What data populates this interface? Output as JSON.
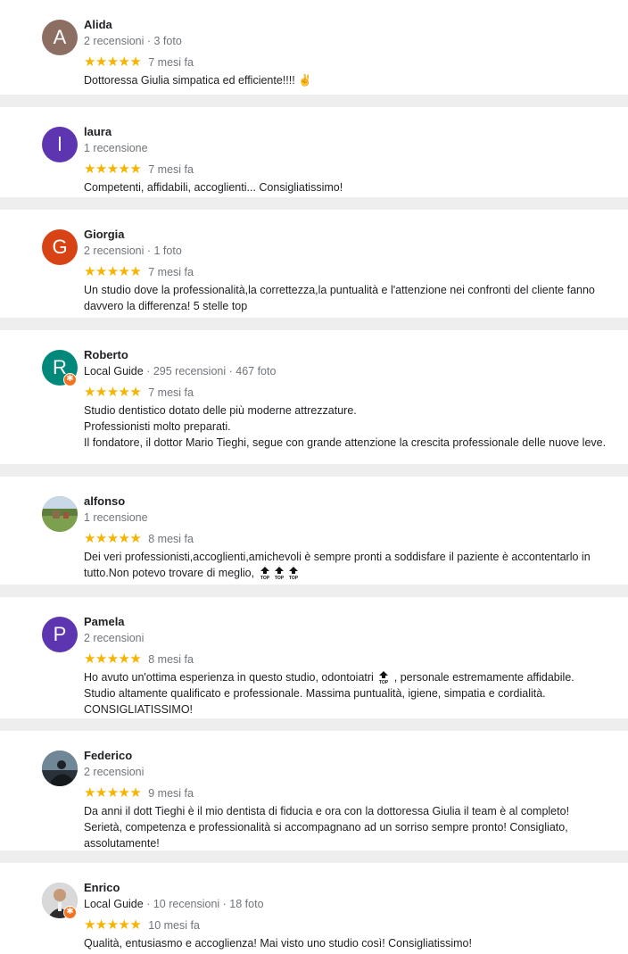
{
  "reviews": [
    {
      "name": "Alida",
      "initial": "A",
      "avatar_color": "#8d6e63",
      "local_guide": "",
      "stats": "2 recensioni · 3 foto",
      "stars": "★★★★★",
      "rating": 5,
      "time": "7 mesi fa",
      "text": "Dottoressa Giulia  simpatica ed efficiente!!!! ✌"
    },
    {
      "name": "laura",
      "initial": "l",
      "avatar_color": "#5e35b1",
      "local_guide": "",
      "stats": "1 recensione",
      "stars": "★★★★★",
      "rating": 5,
      "time": "7 mesi fa",
      "text": "Competenti, affidabili, accoglienti... Consigliatissimo!"
    },
    {
      "name": "Giorgia",
      "initial": "G",
      "avatar_color": "#d84315",
      "local_guide": "",
      "stats": "2 recensioni · 1 foto",
      "stars": "★★★★★",
      "rating": 5,
      "time": "7 mesi fa",
      "text": "Un studio dove la professionalità,la correttezza,la puntualità e l'attenzione nei confronti del cliente fanno davvero la differenza! 5 stelle top"
    },
    {
      "name": "Roberto",
      "initial": "R",
      "avatar_color": "#00897b",
      "local_guide": "Local Guide",
      "stats": "· 295 recensioni · 467 foto",
      "stars": "★★★★★",
      "rating": 5,
      "time": "7 mesi fa",
      "text": "Studio dentistico dotato delle più moderne attrezzature.\nProfessionisti molto preparati.\nIl fondatore, il dottor Mario Tieghi, segue con grande attenzione la crescita professionale delle nuove leve."
    },
    {
      "name": "alfonso",
      "initial": "",
      "avatar_color": "#6b8e4e",
      "local_guide": "",
      "stats": "1 recensione",
      "stars": "★★★★★",
      "rating": 5,
      "time": "8 mesi fa",
      "text": "Dei veri professionisti,accoglienti,amichevoli è sempre pronti a soddisfare il paziente è accontentarlo in tutto.Non potevo trovare di meglio, ",
      "top_icons": 3
    },
    {
      "name": "Pamela",
      "initial": "P",
      "avatar_color": "#5e35b1",
      "local_guide": "",
      "stats": "2 recensioni",
      "stars": "★★★★★",
      "rating": 5,
      "time": "8 mesi fa",
      "text": "Ho avuto un'ottima esperienza in questo studio, odontoiatri ",
      "text_after": " , personale estremamente affidabile.\nStudio altamente qualificato e professionale. Massima puntualità, igiene, simpatia e cordialità.\nCONSIGLIATISSIMO!",
      "top_icons": 1
    },
    {
      "name": "Federico",
      "initial": "",
      "avatar_color": "#3d5366",
      "local_guide": "",
      "stats": "2 recensioni",
      "stars": "★★★★★",
      "rating": 5,
      "time": "9 mesi fa",
      "text": "Da anni il dott Tieghi è il mio dentista di fiducia e ora con la dottoressa Giulia il team è al completo!\nSerietà, competenza e professionalità si accompagnano ad un sorriso sempre pronto! Consigliato, assolutamente!"
    },
    {
      "name": "Enrico",
      "initial": "",
      "avatar_color": "#9e9e9e",
      "local_guide": "Local Guide",
      "stats": "· 10 recensioni · 18 foto",
      "stars": "★★★★★",
      "rating": 5,
      "time": "10 mesi fa",
      "text": "Qualità, entusiasmo e accoglienza! Mai visto uno studio così! Consigliatissimo!"
    }
  ]
}
